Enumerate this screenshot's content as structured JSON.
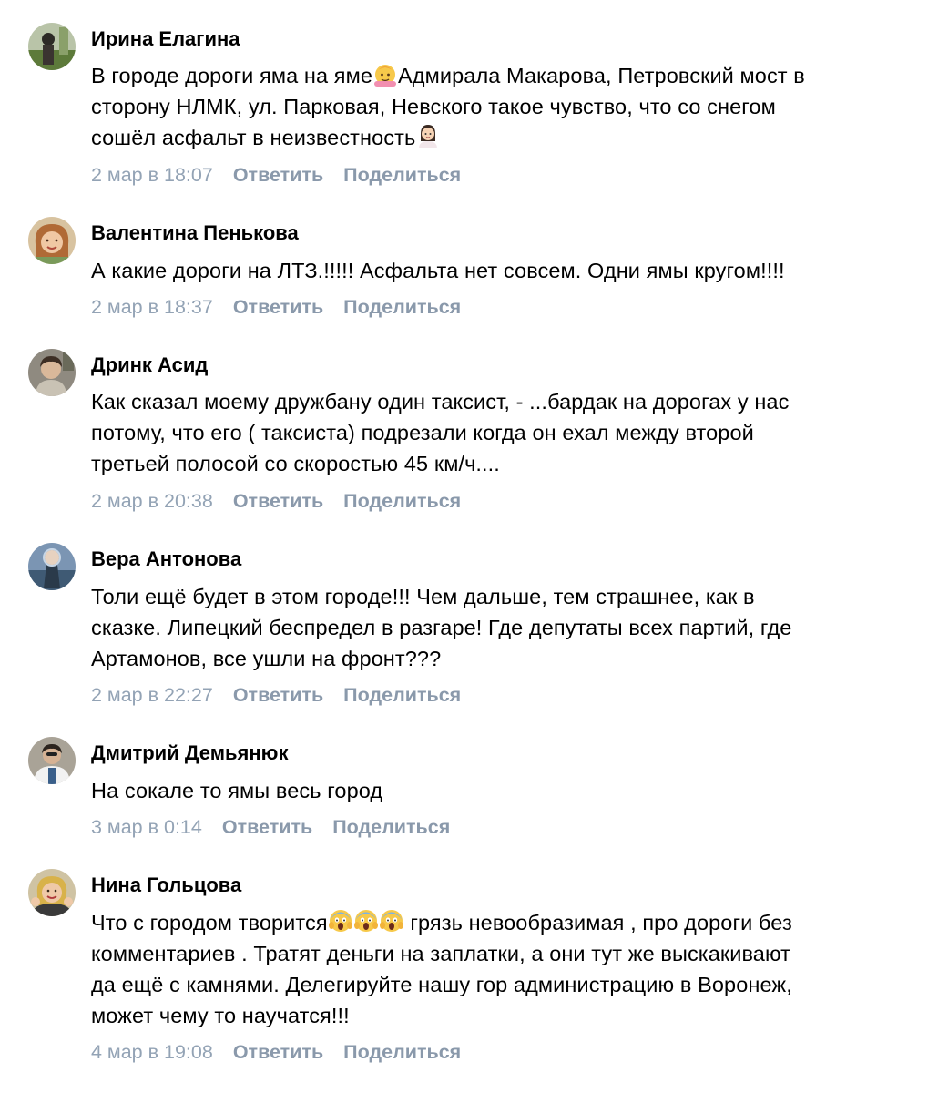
{
  "comments": [
    {
      "author": "Ирина Елагина",
      "avatar_icon": "avatar-photo-icon",
      "text_lines": [
        [
          "В городе дороги яма на яме",
          "emoji:person-raising-hand",
          "Адмирала Макарова, Петровский мост в"
        ],
        [
          "сторону НЛМК, ул. Парковая, Невского такое чувство, что со снегом"
        ],
        [
          "сошёл асфальт в неизвестность",
          "emoji:person-shrugging"
        ]
      ],
      "date": "2 мар в 18:07",
      "reply": "Ответить",
      "share": "Поделиться"
    },
    {
      "author": "Валентина Пенькова",
      "avatar_icon": "avatar-photo-icon",
      "text_lines": [
        [
          "А какие дороги на ЛТЗ.!!!!! Асфальта нет совсем. Одни ямы кругом!!!!"
        ]
      ],
      "date": "2 мар в 18:37",
      "reply": "Ответить",
      "share": "Поделиться"
    },
    {
      "author": "Дринк Асид",
      "avatar_icon": "avatar-photo-icon",
      "text_lines": [
        [
          "Как сказал моему дружбану один таксист, - ...бардак на дорогах у нас"
        ],
        [
          "потому, что его ( таксиста) подрезали когда он ехал между второй"
        ],
        [
          "третьей полосой со скоростью 45 км/ч...."
        ]
      ],
      "date": "2 мар в 20:38",
      "reply": "Ответить",
      "share": "Поделиться"
    },
    {
      "author": "Вера Антонова",
      "avatar_icon": "avatar-photo-icon",
      "text_lines": [
        [
          "Толи ещё будет в этом городе!!! Чем дальше, тем страшнее, как в"
        ],
        [
          "сказке. Липецкий беспредел в разгаре! Где депутаты всех партий, где"
        ],
        [
          "Артамонов, все ушли на фронт???"
        ]
      ],
      "date": "2 мар в 22:27",
      "reply": "Ответить",
      "share": "Поделиться"
    },
    {
      "author": "Дмитрий Демьянюк",
      "avatar_icon": "avatar-photo-icon",
      "text_lines": [
        [
          "На сокале то ямы весь город"
        ]
      ],
      "date": "3 мар в 0:14",
      "reply": "Ответить",
      "share": "Поделиться"
    },
    {
      "author": "Нина Гольцова",
      "avatar_icon": "avatar-photo-icon",
      "text_lines": [
        [
          "Что с городом творится",
          "emoji:face-screaming",
          "emoji:face-screaming",
          "emoji:face-screaming",
          " грязь невообразимая , про дороги без"
        ],
        [
          "комментариев . Тратят деньги на заплатки, а они тут же выскакивают"
        ],
        [
          "да ещё с камнями. Делегируйте нашу гор администрацию в Воронеж,"
        ],
        [
          "может чему то научатся!!!"
        ]
      ],
      "date": "4 мар в 19:08",
      "reply": "Ответить",
      "share": "Поделиться"
    }
  ],
  "colors": {
    "date": "#93a3b5",
    "action": "#8a99ab",
    "text": "#000000"
  }
}
